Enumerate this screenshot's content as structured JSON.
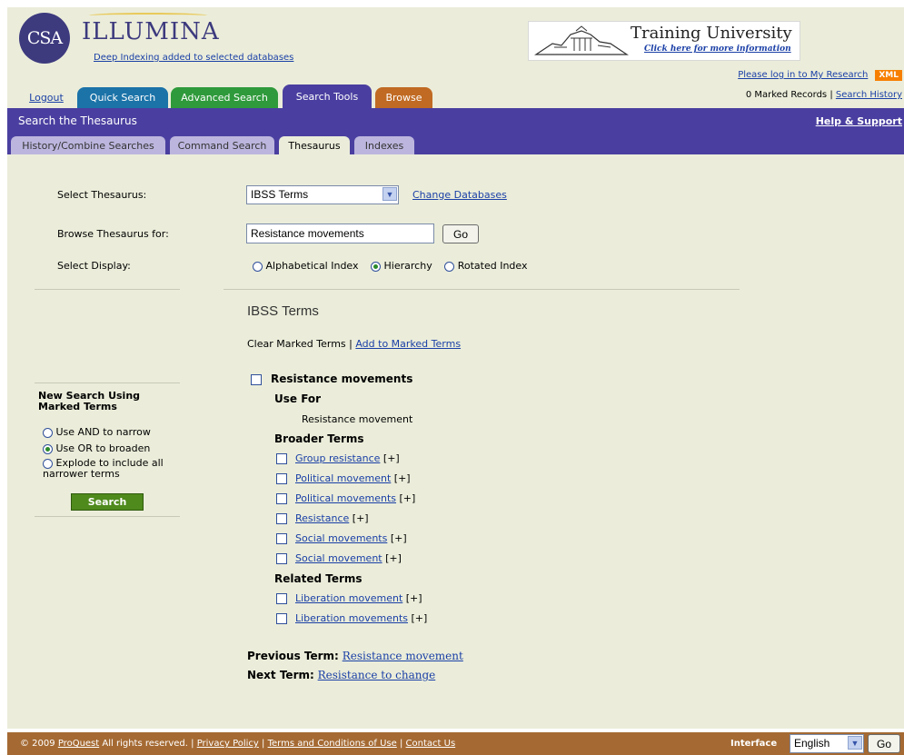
{
  "header": {
    "logo": "CSA",
    "brand": "ILLUMINA",
    "brand_sub": "Deep Indexing added to selected databases",
    "banner_title": "Training University",
    "banner_sub": "Click here for more information",
    "my_research": "Please log in to My Research",
    "xml": "XML",
    "marked_records": "0 Marked Records",
    "search_history": "Search History",
    "tabs": [
      {
        "label": "Logout",
        "color": "#ebedda"
      },
      {
        "label": "Quick Search",
        "color": "#1b73a8"
      },
      {
        "label": "Advanced Search",
        "color": "#2f9a3b"
      },
      {
        "label": "Search Tools",
        "color": "#4a3fa0"
      },
      {
        "label": "Browse",
        "color": "#c06a23"
      }
    ]
  },
  "section": {
    "title": "Search the Thesaurus",
    "help": "Help & Support",
    "subtabs": [
      "History/Combine Searches",
      "Command Search",
      "Thesaurus",
      "Indexes"
    ],
    "active_subtab": "Thesaurus"
  },
  "form": {
    "select_thesaurus_label": "Select Thesaurus:",
    "thesaurus_value": "IBSS Terms",
    "change_databases": "Change Databases",
    "browse_label": "Browse Thesaurus for:",
    "browse_value": "Resistance movements",
    "go": "Go",
    "display_label": "Select Display:",
    "display_options": [
      "Alphabetical Index",
      "Hierarchy",
      "Rotated Index"
    ],
    "display_selected": "Hierarchy"
  },
  "sidebar": {
    "title": "New Search Using Marked Terms",
    "options": [
      "Use AND to narrow",
      "Use OR to broaden",
      "Explode to include all narrower terms"
    ],
    "selected": "Use OR to broaden",
    "search_button": "Search"
  },
  "results": {
    "heading": "IBSS Terms",
    "clear_marked": "Clear Marked Terms",
    "add_marked": "Add to Marked Terms",
    "main_term": "Resistance movements",
    "use_for_label": "Use For",
    "use_for": [
      "Resistance movement"
    ],
    "broader_label": "Broader Terms",
    "broader": [
      "Group resistance",
      "Political movement",
      "Political movements",
      "Resistance",
      "Social movements",
      "Social movement"
    ],
    "related_label": "Related Terms",
    "related": [
      "Liberation movement",
      "Liberation movements"
    ],
    "expand": "[+]",
    "previous_label": "Previous Term:",
    "previous_term": "Resistance movement",
    "next_label": "Next Term:",
    "next_term": "Resistance to change"
  },
  "footer": {
    "copyright_year": "© 2009",
    "proquest": "ProQuest",
    "rights": "All rights reserved.",
    "links": [
      "Privacy Policy",
      "Terms and Conditions of Use",
      "Contact Us"
    ],
    "interface_label": "Interface",
    "language": "English",
    "go": "Go"
  }
}
